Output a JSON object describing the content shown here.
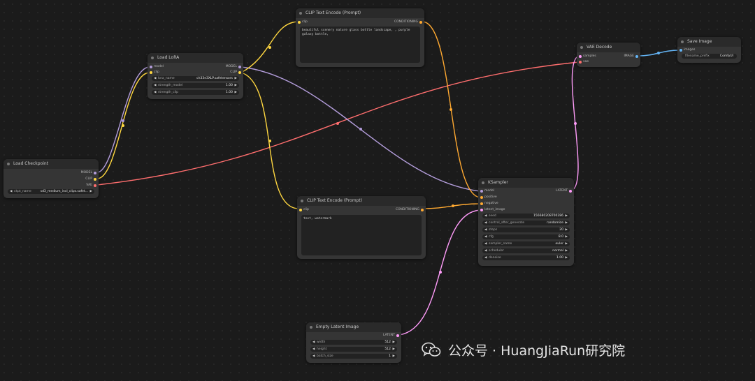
{
  "colors": {
    "model": "#b39ddb",
    "clip": "#ffd740",
    "vae": "#ff6e6e",
    "conditioning": "#ffa931",
    "latent": "#ff9cf9",
    "image": "#64b5f6"
  },
  "nodes": {
    "load_checkpoint": {
      "title": "Load Checkpoint",
      "outputs": [
        "MODEL",
        "CLIP",
        "VAE"
      ],
      "widgets": [
        {
          "label": "ckpt_name",
          "value": "sd3_medium_incl_clips.safet..."
        }
      ]
    },
    "load_lora": {
      "title": "Load LoRA",
      "inputs": [
        "model",
        "clip"
      ],
      "outputs": [
        "MODEL",
        "CLIP"
      ],
      "widgets": [
        {
          "label": "lora_name",
          "value": "ch33e3XLP.safetensors"
        },
        {
          "label": "strength_model",
          "value": "1.00"
        },
        {
          "label": "strength_clip",
          "value": "1.00"
        }
      ]
    },
    "clip_encode_pos": {
      "title": "CLIP Text Encode (Prompt)",
      "inputs": [
        "clip"
      ],
      "outputs": [
        "CONDITIONING"
      ],
      "text": "beautiful scenery nature glass bottle landscape, , purple galaxy bottle,"
    },
    "clip_encode_neg": {
      "title": "CLIP Text Encode (Prompt)",
      "inputs": [
        "clip"
      ],
      "outputs": [
        "CONDITIONING"
      ],
      "text": "text, watermark"
    },
    "vae_decode": {
      "title": "VAE Decode",
      "inputs": [
        "samples",
        "vae"
      ],
      "outputs": [
        "IMAGE"
      ]
    },
    "save_image": {
      "title": "Save Image",
      "inputs": [
        "images"
      ],
      "widgets": [
        {
          "label": "filename_prefix",
          "value": "ComfyUI"
        }
      ]
    },
    "ksampler": {
      "title": "KSampler",
      "inputs": [
        "model",
        "positive",
        "negative",
        "latent_image"
      ],
      "outputs": [
        "LATENT"
      ],
      "widgets": [
        {
          "label": "seed",
          "value": "156680208700286"
        },
        {
          "label": "control_after_generate",
          "value": "randomize"
        },
        {
          "label": "steps",
          "value": "20"
        },
        {
          "label": "cfg",
          "value": "8.0"
        },
        {
          "label": "sampler_name",
          "value": "euler"
        },
        {
          "label": "scheduler",
          "value": "normal"
        },
        {
          "label": "denoise",
          "value": "1.00"
        }
      ]
    },
    "empty_latent": {
      "title": "Empty Latent Image",
      "outputs": [
        "LATENT"
      ],
      "widgets": [
        {
          "label": "width",
          "value": "512"
        },
        {
          "label": "height",
          "value": "512"
        },
        {
          "label": "batch_size",
          "value": "1"
        }
      ]
    }
  },
  "watermark": {
    "text": "公众号 · HuangJiaRun研究院",
    "icon": "wechat-icon"
  }
}
